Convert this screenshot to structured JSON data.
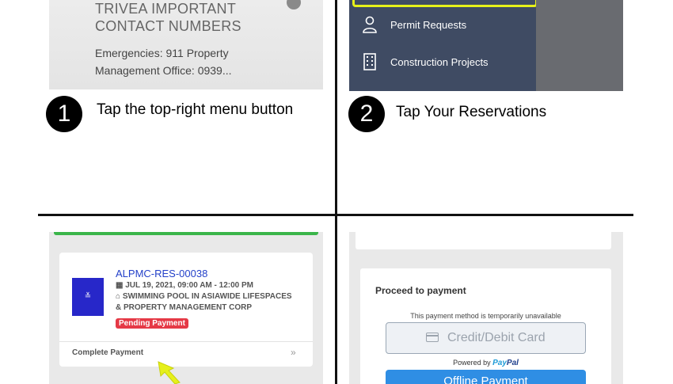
{
  "panel1": {
    "title_line1": "TRIVEA IMPORTANT",
    "title_line2": "CONTACT NUMBERS",
    "body_line1": "Emergencies: 911 Property",
    "body_line2": "Management Office: 0939..."
  },
  "panel2": {
    "menu_items": [
      {
        "label": "Permit Requests",
        "icon": "person-icon"
      },
      {
        "label": "Construction Projects",
        "icon": "building-icon"
      }
    ]
  },
  "steps": [
    {
      "number": "1",
      "text": "Tap the top-right menu button"
    },
    {
      "number": "2",
      "text": "Tap Your Reservations"
    }
  ],
  "panel3": {
    "reservation_id": "ALPMC-RES-00038",
    "date": "JUL 19, 2021, 09:00 AM - 12:00 PM",
    "venue_line1": "SWIMMING POOL IN ASIAWIDE LIFESPACES",
    "venue_line2": "& PROPERTY MANAGEMENT CORP",
    "status": "Pending Payment",
    "action": "Complete Payment"
  },
  "panel4": {
    "heading": "Proceed to payment",
    "notice": "This payment method is temporarily unavailable",
    "card_button": "Credit/Debit Card",
    "powered_by": "Powered by",
    "paypal_pay": "Pay",
    "paypal_pal": "Pal",
    "offline_button": "Offline Payment"
  },
  "colors": {
    "highlight": "#e6f01a",
    "menu_bg": "#3f4b63",
    "link_blue": "#2441c9",
    "badge_red": "#e53946",
    "offline_blue": "#2f8ee4",
    "arrow_yellow": "#e6f01a"
  }
}
